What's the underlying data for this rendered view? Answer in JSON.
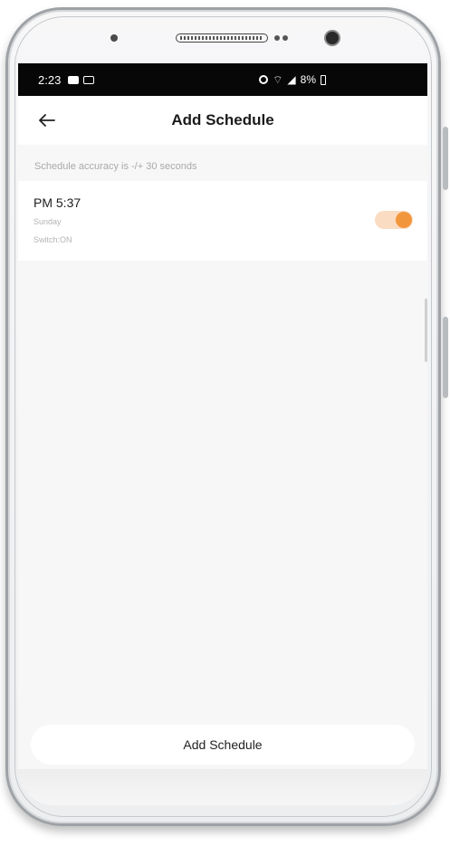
{
  "status_bar": {
    "time": "2:23",
    "battery": "8%"
  },
  "header": {
    "title": "Add Schedule",
    "back_icon": "arrow-left-icon"
  },
  "accuracy_note": "Schedule accuracy is -/+ 30 seconds",
  "schedules": [
    {
      "time": "PM 5:37",
      "day": "Sunday",
      "switch_state": "Switch:ON",
      "enabled": true
    }
  ],
  "add_button_label": "Add Schedule",
  "colors": {
    "toggle_on": "#f2963c",
    "toggle_track": "#f9dcc2",
    "status_bar_bg": "#070707",
    "screen_bg": "#f7f7f7"
  }
}
